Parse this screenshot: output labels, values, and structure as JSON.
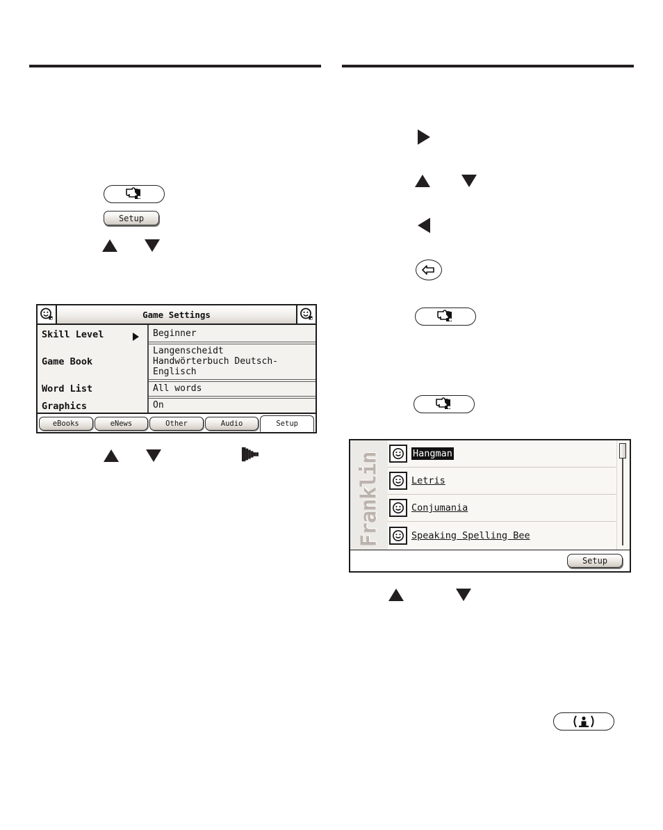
{
  "page": {
    "background_color": "#ffffff",
    "rule_color": "#231f20"
  },
  "left_column": {
    "game_key_button": {
      "icon": "puzzle-piece-icon",
      "label": ""
    },
    "setup_button": {
      "label": "Setup"
    },
    "arrow_up": {
      "icon": "triangle-up-icon"
    },
    "arrow_down": {
      "icon": "triangle-down-icon"
    },
    "below_screen_arrows": {
      "arrow_up": {
        "icon": "triangle-up-icon"
      },
      "arrow_down": {
        "icon": "triangle-down-icon"
      },
      "cursor": {
        "icon": "pixel-right-arrow-cursor-icon"
      }
    }
  },
  "right_column": {
    "arrow_right": {
      "icon": "triangle-right-icon"
    },
    "arrow_up": {
      "icon": "triangle-up-icon"
    },
    "arrow_down": {
      "icon": "triangle-down-icon"
    },
    "arrow_left": {
      "icon": "triangle-left-icon"
    },
    "back_button": {
      "icon": "back-arrow-icon"
    },
    "game_key_button_1": {
      "icon": "puzzle-piece-icon"
    },
    "game_key_button_2": {
      "icon": "puzzle-piece-icon"
    },
    "below_list_arrows": {
      "arrow_up": {
        "icon": "triangle-up-icon"
      },
      "arrow_down": {
        "icon": "triangle-down-icon"
      }
    },
    "info_button": {
      "icon": "info-person-icon",
      "label": "( i )"
    }
  },
  "game_settings_screen": {
    "titlebar": {
      "left_icon": "smiley-app-icon",
      "title": "Game Settings",
      "right_icon": "smiley-app-icon"
    },
    "rows": [
      {
        "label": "Skill Level",
        "value": "Beginner",
        "has_caret": true
      },
      {
        "label": "Game Book",
        "value": "Langenscheidt\nHandwörterbuch Deutsch-\nEnglisch",
        "has_caret": false
      },
      {
        "label": "Word List",
        "value": "All words",
        "has_caret": false
      },
      {
        "label": "Graphics",
        "value": "On",
        "has_caret": false
      }
    ],
    "row_values": {
      "skill_level": "Beginner",
      "game_book_line1": "Langenscheidt",
      "game_book_line2": "Handwörterbuch Deutsch-",
      "game_book_line3": "Englisch",
      "word_list": "All words",
      "graphics": "On"
    },
    "row_labels": {
      "skill_level": "Skill Level",
      "game_book": "Game Book",
      "word_list": "Word List",
      "graphics": "Graphics"
    },
    "tabs": [
      {
        "label": "eBooks",
        "active": false
      },
      {
        "label": "eNews",
        "active": false
      },
      {
        "label": "Other",
        "active": false
      },
      {
        "label": "Audio",
        "active": false
      },
      {
        "label": "Setup",
        "active": true
      }
    ]
  },
  "game_list_screen": {
    "brand": "Franklin",
    "items": [
      {
        "label": "Hangman",
        "icon": "smiley-app-icon",
        "selected": true
      },
      {
        "label": "Letris",
        "icon": "smiley-app-icon",
        "selected": false
      },
      {
        "label": "Conjumania",
        "icon": "smiley-app-icon",
        "selected": false
      },
      {
        "label": "Speaking Spelling Bee",
        "icon": "smiley-app-icon",
        "selected": false
      }
    ],
    "scrollbar": {
      "thumb_position": "top"
    },
    "setup_button": {
      "label": "Setup"
    }
  }
}
